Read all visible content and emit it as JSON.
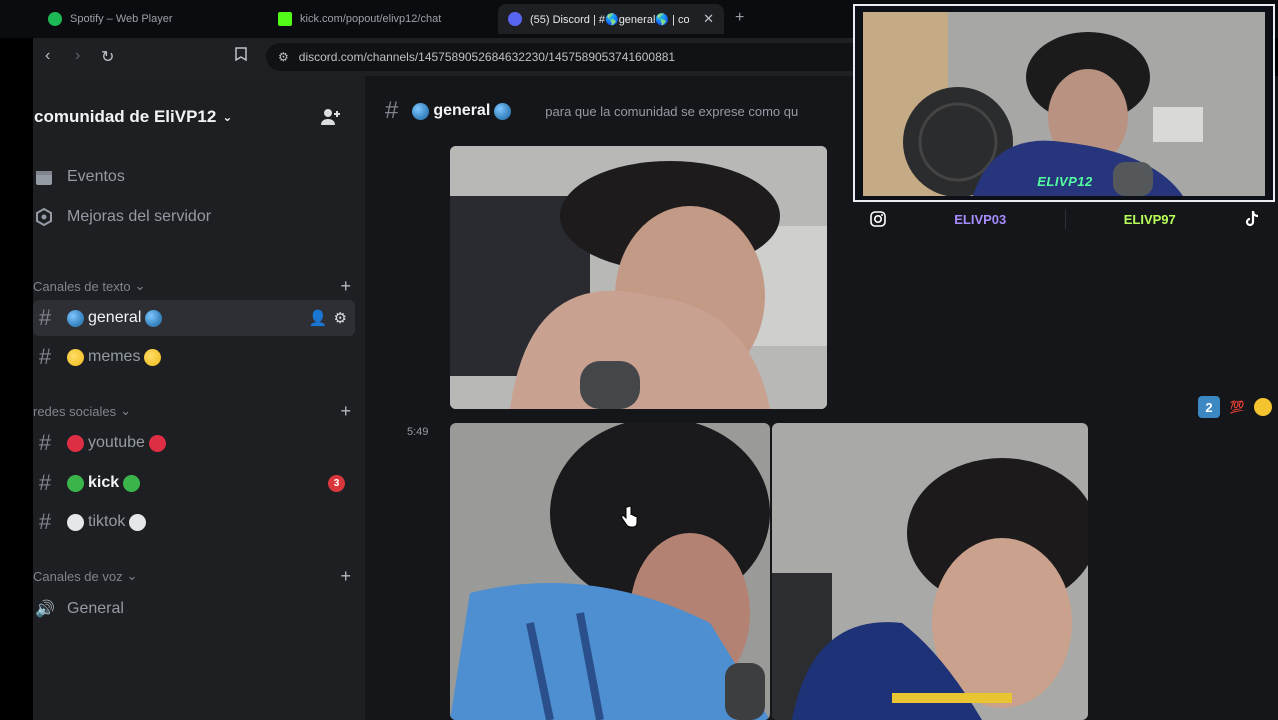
{
  "browser": {
    "tabs": [
      {
        "label": "Spotify – Web Player",
        "color": "#1db954"
      },
      {
        "label": "kick.com/popout/elivp12/chat",
        "color": "#53fc18"
      },
      {
        "label": "(55) Discord | #🌎general🌎 | co",
        "color": "#5865f2"
      }
    ],
    "url": "discord.com/channels/1457589052684632230/1457589053741600881"
  },
  "server": {
    "name": "comunidad de EliVP12",
    "items": [
      {
        "label": "Eventos",
        "icon": "calendar-icon"
      },
      {
        "label": "Mejoras del servidor",
        "icon": "boost-icon"
      }
    ],
    "categories": [
      {
        "label": "Canales de texto",
        "channels": [
          {
            "name": "general",
            "emoji_color": "#3b88c3",
            "active": true
          },
          {
            "name": "memes",
            "emoji_color": "#f4c430",
            "active": false
          }
        ]
      },
      {
        "label": "redes sociales",
        "channels": [
          {
            "name": "youtube",
            "emoji_color": "#dd2e44",
            "active": false
          },
          {
            "name": "kick",
            "emoji_color": "#3bb54a",
            "active": false,
            "badge": "3"
          },
          {
            "name": "tiktok",
            "emoji_color": "#e6e7e8",
            "active": false
          }
        ]
      },
      {
        "label": "Canales de voz",
        "channels": [
          {
            "name": "General",
            "voice": true
          }
        ]
      }
    ]
  },
  "chat": {
    "channel": "general",
    "topic": "para que la comunidad se exprese como qu",
    "timestamp": "5:49",
    "reactions": [
      "2",
      "💯",
      "😆"
    ]
  },
  "stream": {
    "cam_name": "ELIVP12",
    "socials": [
      "ELIVP03",
      "ELIVP97"
    ],
    "colors": {
      "accent": "#52ffa0",
      "social1": "#a68cff",
      "social2": "#b9ff5a"
    }
  }
}
